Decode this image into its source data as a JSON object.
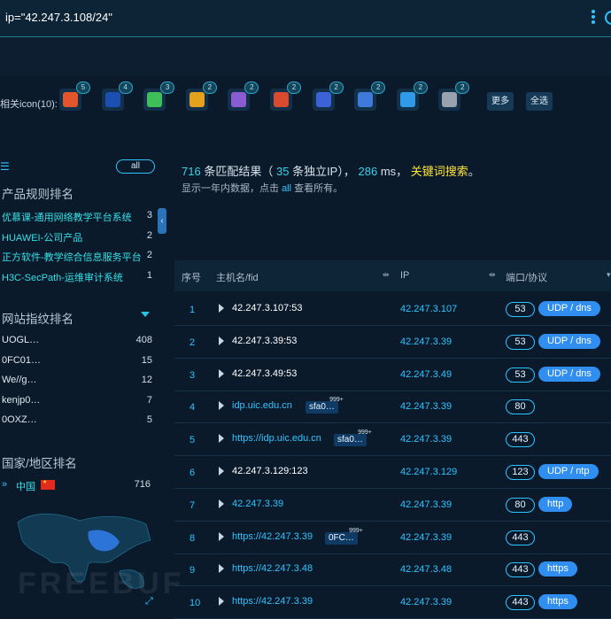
{
  "search": {
    "query": "ip=\"42.247.3.108/24\""
  },
  "icons": {
    "label": "相关icon(10):",
    "items": [
      {
        "name": "orange-logo-icon",
        "count": "5",
        "color": "#e2552d"
      },
      {
        "name": "blue-circle-icon",
        "count": "4",
        "color": "#1d4fb3"
      },
      {
        "name": "green-dragon-icon",
        "count": "3",
        "color": "#3fbf5a"
      },
      {
        "name": "cube-icon",
        "count": "2",
        "color": "#e4a21c"
      },
      {
        "name": "purple-seal-icon",
        "count": "2",
        "color": "#8a5bd1"
      },
      {
        "name": "house-icon",
        "count": "2",
        "color": "#d94a2e"
      },
      {
        "name": "shield-icon",
        "count": "2",
        "color": "#3b62d6"
      },
      {
        "name": "university-seal-icon",
        "count": "2",
        "color": "#3d7ad9"
      },
      {
        "name": "check-arrow-icon",
        "count": "2",
        "color": "#2f9be8"
      },
      {
        "name": "gray-badge-icon",
        "count": "2",
        "color": "#9aa3ad"
      }
    ],
    "more_label": "更多",
    "select_all_label": "全选"
  },
  "left": {
    "all_label": "all",
    "rules_title": "产品规则排名",
    "rules": [
      {
        "name": "优慕课-通用网络教学平台系统",
        "count": "3"
      },
      {
        "name": "HUAWEI-公司产品",
        "count": "2"
      },
      {
        "name": "正方软件-教学综合信息服务平台",
        "count": "2"
      },
      {
        "name": "H3C-SecPath-运维审计系统",
        "count": "1"
      }
    ],
    "fp_title": "网站指纹排名",
    "fingerprints": [
      {
        "name": "UOGL…",
        "count": "408"
      },
      {
        "name": "0FC01…",
        "count": "15"
      },
      {
        "name": "We//g…",
        "count": "12"
      },
      {
        "name": "kenjp0…",
        "count": "7"
      },
      {
        "name": "0OXZ…",
        "count": "5"
      }
    ],
    "country_title": "国家/地区排名",
    "country": {
      "name": "中国",
      "count": "716"
    }
  },
  "summary": {
    "total": "716",
    "matched_label": "条匹配结果（",
    "unique_ip": "35",
    "unique_label": "条独立IP），",
    "ms": "286",
    "ms_label": "ms，",
    "keyword_link": "关键词搜索",
    "end": "。",
    "sub_prefix": "显示一年内数据，点击",
    "sub_link": "all",
    "sub_suffix": "查看所有。"
  },
  "table": {
    "headers": {
      "index": "序号",
      "host": "主机名/fid",
      "ip": "IP",
      "port": "端口/协议"
    },
    "rows": [
      {
        "index": "1",
        "host": "42.247.3.107:53",
        "ip": "42.247.3.107",
        "port": "53",
        "proto": "UDP / dns"
      },
      {
        "index": "2",
        "host": "42.247.3.39:53",
        "ip": "42.247.3.39",
        "port": "53",
        "proto": "UDP / dns"
      },
      {
        "index": "3",
        "host": "42.247.3.49:53",
        "ip": "42.247.3.49",
        "port": "53",
        "proto": "UDP / dns"
      },
      {
        "index": "4",
        "host": "idp.uic.edu.cn",
        "fid": "sfa0…",
        "fid_sup": "999+",
        "ip": "42.247.3.39",
        "port": "80",
        "proto": ""
      },
      {
        "index": "5",
        "host": "https://idp.uic.edu.cn",
        "fid": "sfa0…",
        "fid_sup": "999+",
        "ip": "42.247.3.39",
        "port": "443",
        "proto": ""
      },
      {
        "index": "6",
        "host": "42.247.3.129:123",
        "ip": "42.247.3.129",
        "port": "123",
        "proto": "UDP / ntp"
      },
      {
        "index": "7",
        "host": "42.247.3.39",
        "ip": "42.247.3.39",
        "port": "80",
        "proto": "http"
      },
      {
        "index": "8",
        "host": "https://42.247.3.39",
        "fid": "0FC…",
        "fid_sup": "999+",
        "ip": "42.247.3.39",
        "port": "443",
        "proto": ""
      },
      {
        "index": "9",
        "host": "https://42.247.3.48",
        "ip": "42.247.3.48",
        "port": "443",
        "proto": "https"
      },
      {
        "index": "10",
        "host": "https://42.247.3.39",
        "ip": "42.247.3.39",
        "port": "443",
        "proto": "https"
      }
    ]
  },
  "watermark": "FREEBUF"
}
